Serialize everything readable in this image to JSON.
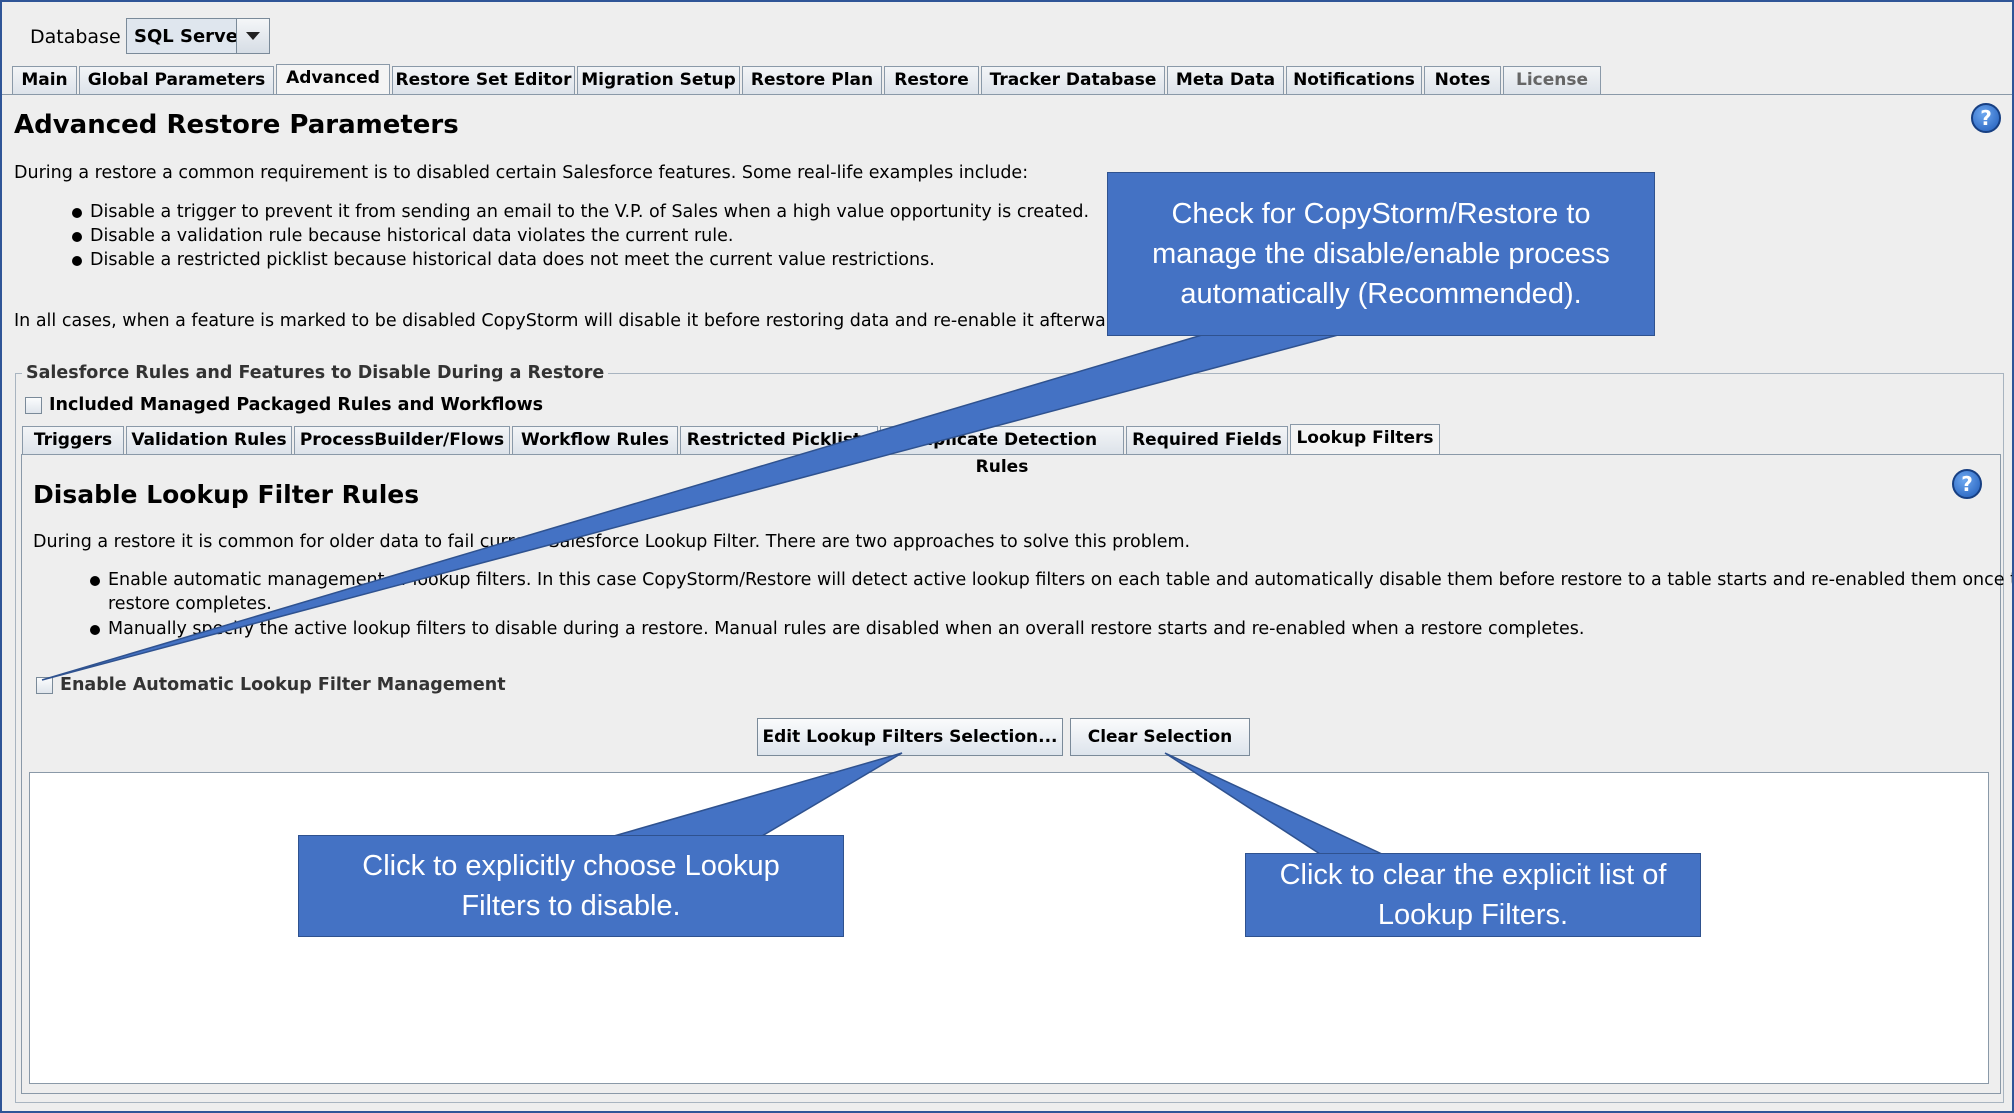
{
  "toolbar": {
    "database_label": "Database",
    "database_value": "SQL Server"
  },
  "main_tabs": [
    "Main",
    "Global Parameters",
    "Advanced",
    "Restore Set Editor",
    "Migration Setup",
    "Restore Plan",
    "Restore",
    "Tracker Database",
    "Meta Data",
    "Notifications",
    "Notes",
    "License"
  ],
  "selected_main_tab": "Advanced",
  "page": {
    "title": "Advanced Restore Parameters",
    "intro": "During a restore a common requirement is to disabled certain Salesforce features. Some real-life examples include:",
    "bullets": [
      "Disable a trigger to prevent it from sending an email to the V.P. of Sales when a high value opportunity is created.",
      "Disable a validation rule because historical data violates the current rule.",
      "Disable a restricted picklist because historical data does not meet the current value restrictions."
    ],
    "summary": "In all cases, when a feature is marked to be disabled CopyStorm will disable it before restoring data and re-enable it afterwards.",
    "help_icon": "question-help-icon"
  },
  "rules_group": {
    "legend": "Salesforce Rules and Features to Disable During a Restore",
    "included_managed_label": "Included Managed Packaged Rules and Workflows",
    "included_managed_checked": false,
    "tabs": [
      "Triggers",
      "Validation Rules",
      "ProcessBuilder/Flows",
      "Workflow Rules",
      "Restricted Picklists",
      "Duplicate Detection Rules",
      "Required Fields",
      "Lookup Filters"
    ],
    "selected_tab": "Lookup Filters"
  },
  "lookup_filters": {
    "title": "Disable Lookup Filter Rules",
    "intro": "During a restore it is common for older data to fail current Salesforce Lookup Filter. There are two approaches to solve this problem.",
    "bullet1_line1": "Enable automatic management of lookup filters. In this case CopyStorm/Restore will detect active lookup filters on each table and automatically disable them before restore to a table starts and re-enabled them once the",
    "bullet1_line2": "restore completes.",
    "bullet2": "Manually specify the active lookup filters to disable during a restore. Manual rules are disabled when an overall restore starts and re-enabled when a restore completes.",
    "auto_label": "Enable Automatic Lookup Filter Management",
    "auto_checked": false,
    "edit_button": "Edit Lookup Filters Selection...",
    "clear_button": "Clear Selection",
    "selected_filters": []
  },
  "callouts": {
    "auto": "Check for CopyStorm/Restore to manage the disable/enable process automatically (Recommended).",
    "edit": "Click to explicitly choose Lookup Filters to disable.",
    "clear": "Click to clear the explicit list of Lookup Filters."
  },
  "colors": {
    "callout_fill": "#4472c4",
    "frame_border": "#2f5597",
    "panel_bg": "#eeeeee"
  }
}
